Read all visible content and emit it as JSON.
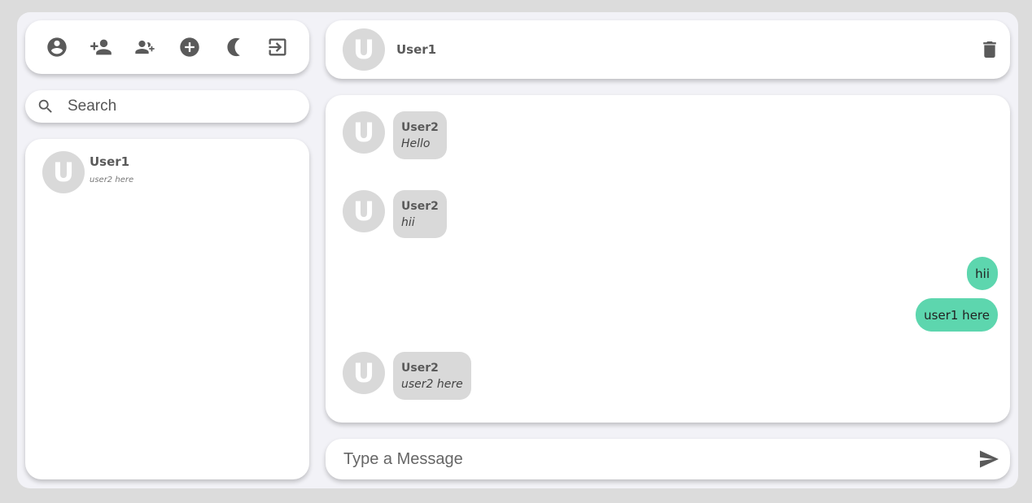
{
  "toolbar": {
    "icons": [
      "account-circle-icon",
      "add-person-icon",
      "add-group-icon",
      "add-circle-icon",
      "moon-icon",
      "logout-icon"
    ]
  },
  "search": {
    "placeholder": "Search"
  },
  "contacts": [
    {
      "avatar": "U",
      "name": "User1",
      "preview": "user2 here"
    }
  ],
  "chat": {
    "header": {
      "avatar": "U",
      "name": "User1"
    },
    "messages": [
      {
        "direction": "in",
        "avatar": "U",
        "sender": "User2",
        "text": "Hello"
      },
      {
        "direction": "in",
        "avatar": "U",
        "sender": "User2",
        "text": "hii"
      },
      {
        "direction": "out",
        "text": "hii"
      },
      {
        "direction": "out",
        "text": "user1 here"
      },
      {
        "direction": "in",
        "avatar": "U",
        "sender": "User2",
        "text": "user2 here"
      }
    ]
  },
  "compose": {
    "placeholder": "Type a Message"
  },
  "colors": {
    "outgoing_bubble": "#5dd6ae",
    "incoming_bubble": "#d9d9d9",
    "avatar_bg": "#d9d9d9"
  }
}
